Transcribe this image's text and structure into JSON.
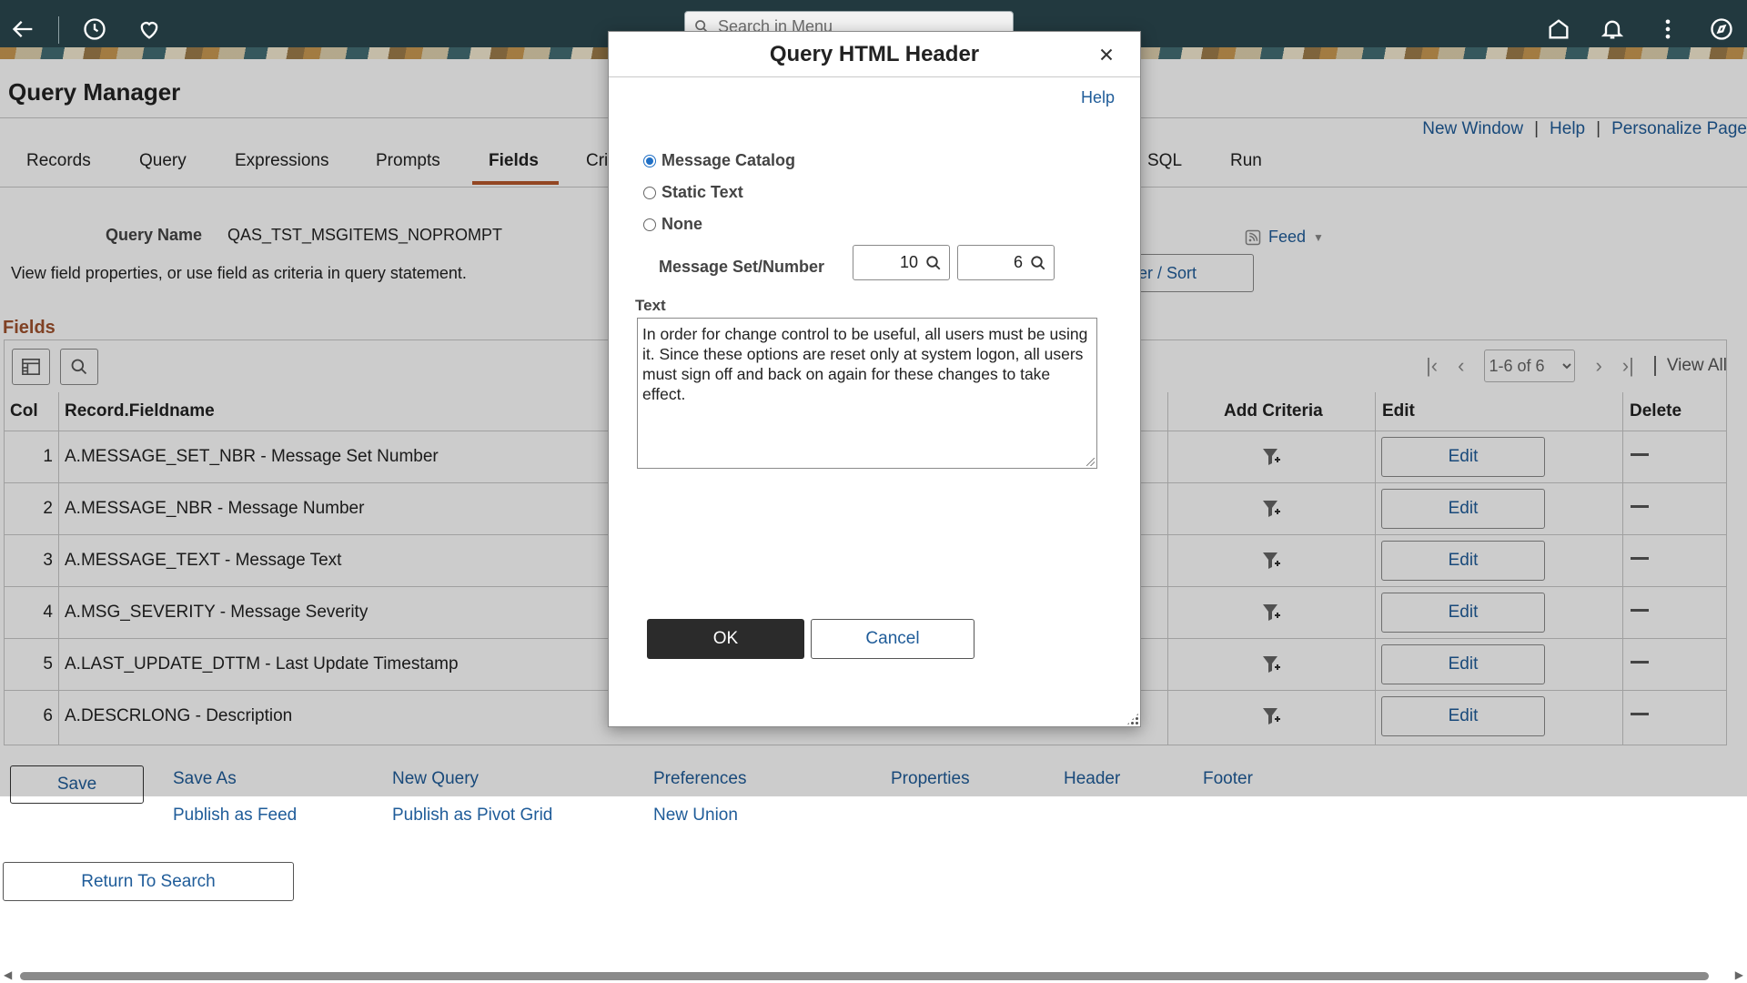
{
  "topbar": {
    "search_placeholder": "Search in Menu",
    "icons": [
      "back-arrow-icon",
      "history-icon",
      "favorite-heart-icon",
      "home-icon",
      "bell-icon",
      "more-vertical-icon",
      "compass-icon"
    ]
  },
  "page": {
    "title": "Query Manager",
    "links": {
      "new_window": "New Window",
      "sep": "|",
      "help": "Help",
      "personalize": "Personalize Page"
    },
    "tabs": [
      "Records",
      "Query",
      "Expressions",
      "Prompts",
      "Fields",
      "Cri",
      "SQL",
      "Run"
    ],
    "active_tab": "Fields",
    "query_name_label": "Query Name",
    "query_name_value": "QAS_TST_MSGITEMS_NOPROMPT",
    "instruction": "View field properties, or use field as criteria in query statement.",
    "feed_label": "Feed",
    "filter_sort_label": "er / Sort",
    "fields_heading": "Fields"
  },
  "grid": {
    "pager_value": "1-6 of 6",
    "view_all": "View All",
    "headers": {
      "col": "Col",
      "fieldname": "Record.Fieldname",
      "add_criteria": "Add Criteria",
      "edit": "Edit",
      "delete": "Delete"
    },
    "rows": [
      {
        "col": "1",
        "name": "A.MESSAGE_SET_NBR - Message Set Number",
        "edit": "Edit"
      },
      {
        "col": "2",
        "name": "A.MESSAGE_NBR - Message Number",
        "edit": "Edit"
      },
      {
        "col": "3",
        "name": "A.MESSAGE_TEXT - Message Text",
        "edit": "Edit"
      },
      {
        "col": "4",
        "name": "A.MSG_SEVERITY - Message Severity",
        "edit": "Edit"
      },
      {
        "col": "5",
        "name": "A.LAST_UPDATE_DTTM - Last Update Timestamp",
        "edit": "Edit"
      },
      {
        "col": "6",
        "name": "A.DESCRLONG - Description",
        "edit": "Edit"
      }
    ]
  },
  "actions": {
    "save": "Save",
    "save_as": "Save As",
    "new_query": "New Query",
    "preferences": "Preferences",
    "properties": "Properties",
    "header": "Header",
    "footer": "Footer",
    "publish_feed": "Publish as Feed",
    "publish_pivot": "Publish as Pivot Grid",
    "new_union": "New Union",
    "return_to_search": "Return To Search"
  },
  "modal": {
    "title": "Query HTML Header",
    "help": "Help",
    "options": [
      {
        "label": "Message Catalog",
        "selected": true
      },
      {
        "label": "Static Text",
        "selected": false
      },
      {
        "label": "None",
        "selected": false
      }
    ],
    "msg_set_number_label": "Message Set/Number",
    "message_set": "10",
    "message_number": "6",
    "text_label": "Text",
    "text": "In order for change control to be useful, all users must be using it.  Since these options are reset only at system logon, all users must sign off and back on again for these changes to take effect.",
    "ok": "OK",
    "cancel": "Cancel"
  },
  "colors": {
    "topbar": "#22393f",
    "link": "#1f5c99",
    "accent_tab": "#b8582c",
    "fields_heading": "#a0522d",
    "ok_button": "#2b2b2b"
  }
}
